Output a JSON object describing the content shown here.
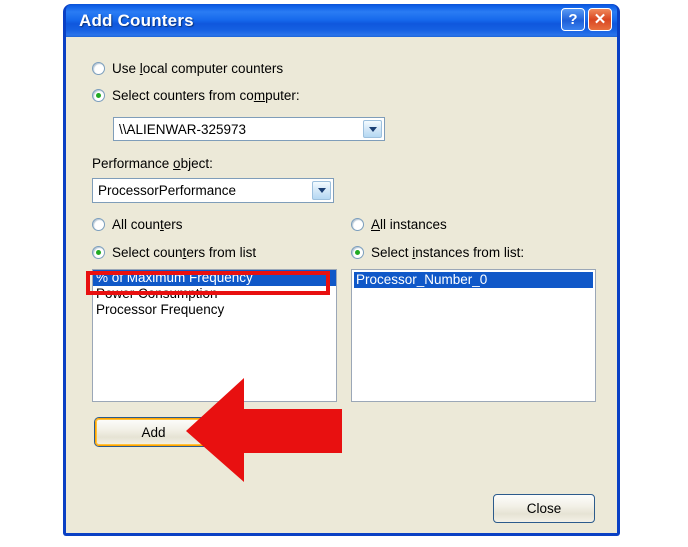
{
  "window": {
    "title": "Add Counters",
    "help_button": "?",
    "close_button": "✕"
  },
  "source": {
    "local_radio_label_pre": "Use ",
    "local_radio_accel": "l",
    "local_radio_label_post": "ocal computer counters",
    "local_selected": false,
    "remote_radio_label_pre": "Select counters from co",
    "remote_radio_accel": "m",
    "remote_radio_label_post": "puter:",
    "remote_selected": true,
    "computer_value": "\\\\ALIENWAR-325973"
  },
  "performance_object": {
    "label_pre": "Performance ",
    "label_accel": "o",
    "label_post": "bject:",
    "value": "ProcessorPerformance"
  },
  "counters": {
    "all_label_pre": "All coun",
    "all_label_accel": "t",
    "all_label_post": "ers",
    "all_selected": false,
    "from_list_label_pre": "Select coun",
    "from_list_label_accel": "t",
    "from_list_label_post": "ers from list",
    "from_list_selected": true,
    "items": [
      {
        "label": "% of Maximum Frequency",
        "selected": true
      },
      {
        "label": "Power Consumption",
        "selected": false
      },
      {
        "label": "Processor Frequency",
        "selected": false
      }
    ]
  },
  "instances": {
    "all_label_pre": "",
    "all_label_accel": "A",
    "all_label_post": "ll instances",
    "all_selected": false,
    "from_list_label_pre": "Select ",
    "from_list_label_accel": "i",
    "from_list_label_post": "nstances from list:",
    "from_list_selected": true,
    "items": [
      {
        "label": "Processor_Number_0",
        "selected": true
      }
    ]
  },
  "buttons": {
    "add": "Add",
    "secondary": "",
    "close": "Close"
  },
  "annotations": {
    "highlight_color": "#e81010",
    "arrow_color": "#e81010",
    "highlight_target": "% of Maximum Frequency",
    "arrow_target": "Add"
  },
  "colors": {
    "dialog_face": "#ece9d8",
    "title_blue": "#1560e2",
    "selection_blue": "#1058c8",
    "radio_dot_green": "#22aa22",
    "focus_orange": "#ffa400"
  }
}
